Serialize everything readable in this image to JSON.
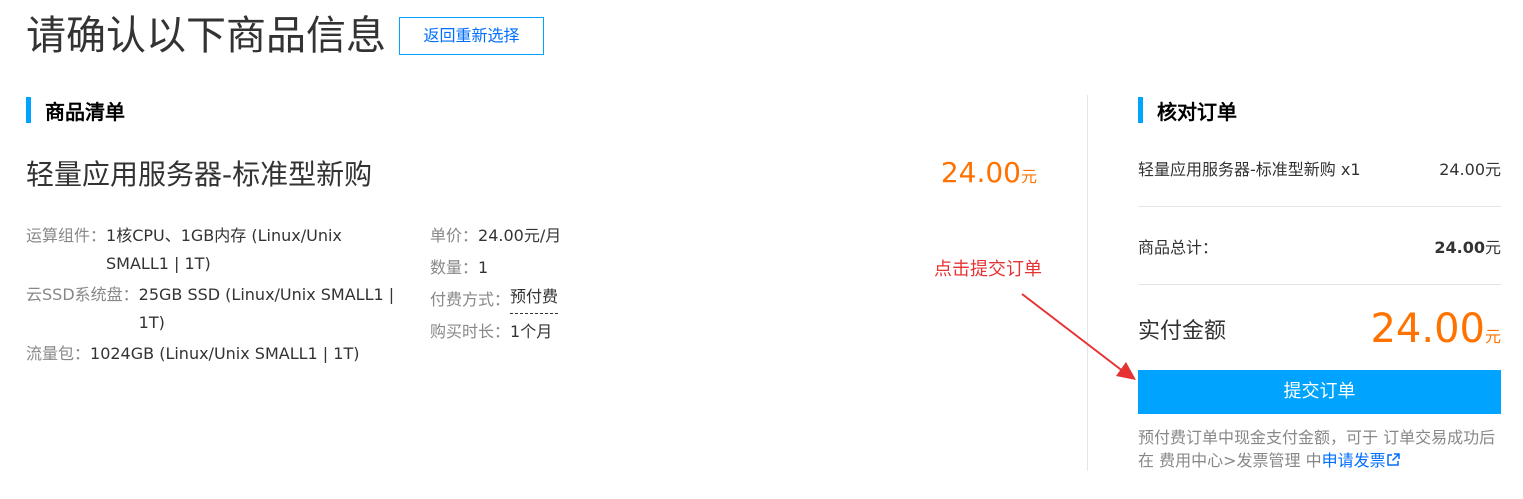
{
  "page_title": "请确认以下商品信息",
  "back_button": "返回重新选择",
  "product_list": {
    "title": "商品清单",
    "product_name": "轻量应用服务器-标准型新购",
    "price": "24.00",
    "price_unit": "元",
    "specs_left": [
      {
        "label": "运算组件：",
        "value": "1核CPU、1GB内存 (Linux/Unix SMALL1 | 1T)"
      },
      {
        "label": "云SSD系统盘：",
        "value": "25GB SSD (Linux/Unix SMALL1 | 1T)"
      },
      {
        "label": "流量包：",
        "value": "1024GB (Linux/Unix SMALL1 | 1T)"
      }
    ],
    "specs_right": [
      {
        "label": "单价：",
        "value": "24.00元/月"
      },
      {
        "label": "数量：",
        "value": "1"
      },
      {
        "label": "付费方式：",
        "value": "预付费"
      },
      {
        "label": "购买时长：",
        "value": "1个月"
      }
    ]
  },
  "annotation": {
    "text": "点击提交订单",
    "color": "#e53333"
  },
  "order_check": {
    "title": "核对订单",
    "line_item": {
      "name": "轻量应用服务器-标准型新购 x1",
      "amount": "24.00元"
    },
    "total": {
      "label": "商品总计：",
      "amount": "24.00",
      "unit": "元"
    },
    "payable": {
      "label": "实付金额",
      "amount": "24.00",
      "unit": "元"
    },
    "submit_button": "提交订单",
    "note_text": "预付费订单中现金支付金额，可于 订单交易成功后 在 费用中心>发票管理 中",
    "note_link": "申请发票"
  },
  "colors": {
    "accent": "#00a4ff",
    "price": "#ff7200",
    "link": "#006eff"
  }
}
